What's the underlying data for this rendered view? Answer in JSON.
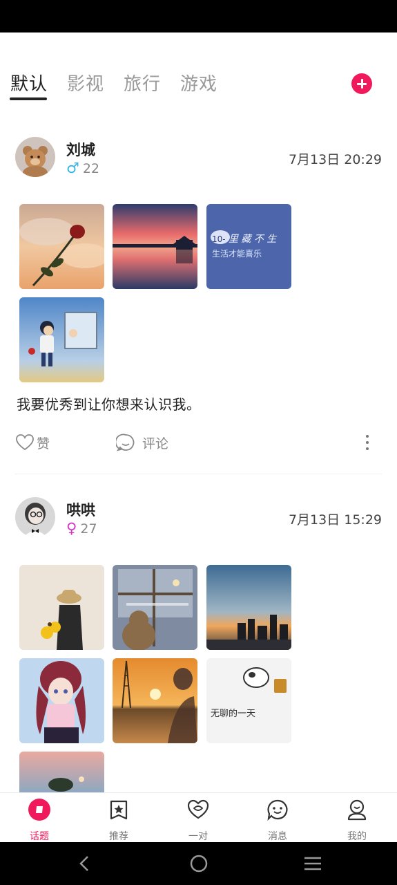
{
  "tabs": [
    {
      "label": "默认",
      "active": true
    },
    {
      "label": "影视",
      "active": false
    },
    {
      "label": "旅行",
      "active": false
    },
    {
      "label": "游戏",
      "active": false
    }
  ],
  "accent_color": "#f0195c",
  "posts": [
    {
      "username": "刘城",
      "gender": "male",
      "gender_icon": "♂",
      "age": "22",
      "time": "7月13日 20:29",
      "photo_text": "10-里 藏 不 生 活 才 能 喜 乐",
      "caption": "我要优秀到让你想来认识我。",
      "like_label": "赞",
      "comment_label": "评论"
    },
    {
      "username": "哄哄",
      "gender": "female",
      "gender_icon": "♀",
      "age": "27",
      "time": "7月13日 15:29",
      "photo_text": "无聊的一天"
    }
  ],
  "bottom_nav": [
    {
      "label": "话题",
      "icon": "topic-icon",
      "active": true
    },
    {
      "label": "推荐",
      "icon": "star-bookmark-icon",
      "active": false
    },
    {
      "label": "一对",
      "icon": "heart-chat-icon",
      "active": false
    },
    {
      "label": "消息",
      "icon": "message-icon",
      "active": false
    },
    {
      "label": "我的",
      "icon": "profile-icon",
      "active": false
    }
  ]
}
